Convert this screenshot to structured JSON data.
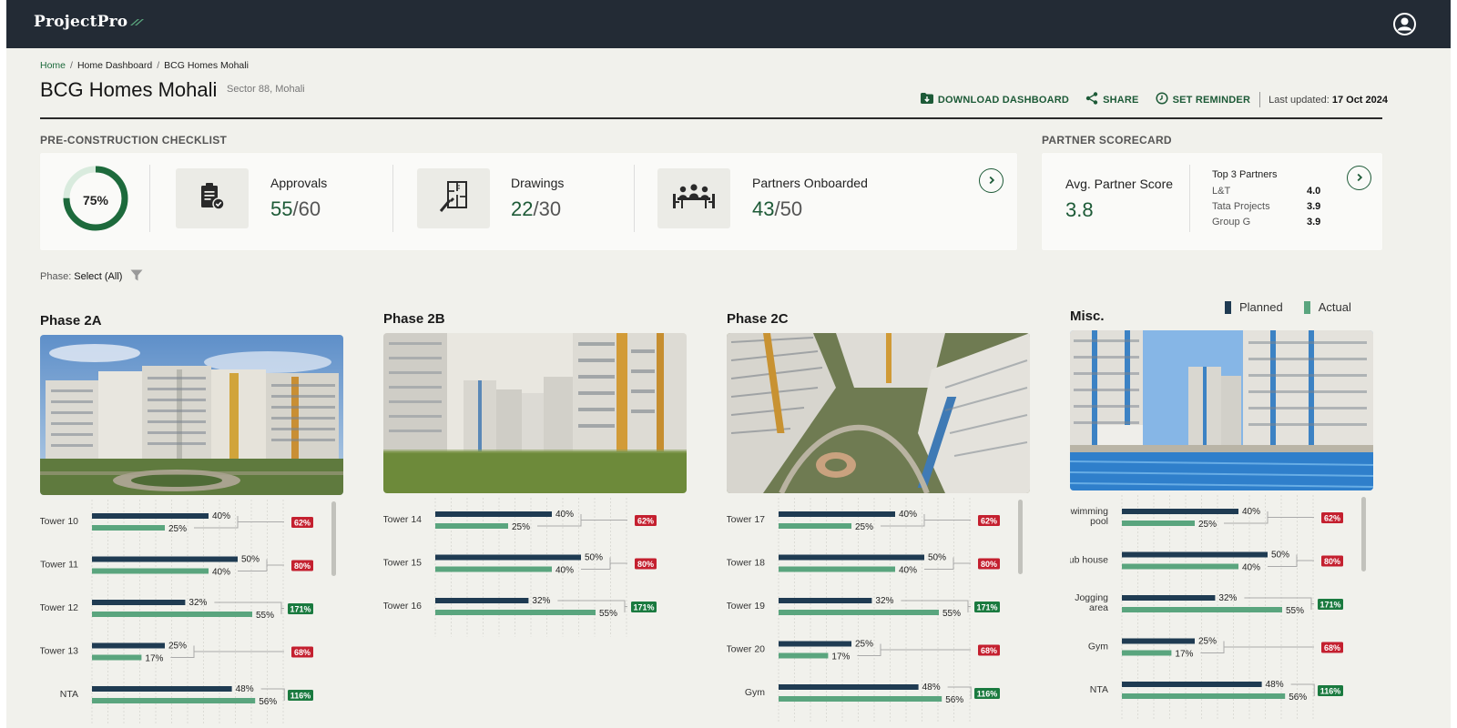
{
  "app": {
    "brand": "ProjectPro"
  },
  "breadcrumb": {
    "home": "Home",
    "sep1": "/",
    "dashboard": "Home Dashboard",
    "sep2": "/",
    "current": "BCG Homes Mohali"
  },
  "page": {
    "title": "BCG Homes Mohali",
    "subtitle": "Sector 88, Mohali"
  },
  "actions": {
    "download": "DOWNLOAD DASHBOARD",
    "share": "SHARE",
    "reminder": "SET REMINDER",
    "last_updated_label": "Last updated:",
    "last_updated_value": "17 Oct 2024"
  },
  "checklist": {
    "label": "PRE-CONSTRUCTION CHECKLIST",
    "progress_label": "75%",
    "progress_fraction": 0.75,
    "kpis": [
      {
        "title": "Approvals",
        "done": "55",
        "total": "/60",
        "icon": "clipboard-check-icon"
      },
      {
        "title": "Drawings",
        "done": "22",
        "total": "/30",
        "icon": "blueprint-icon"
      },
      {
        "title": "Partners Onboarded",
        "done": "43",
        "total": "/50",
        "icon": "meeting-icon"
      }
    ]
  },
  "scorecard": {
    "label": "PARTNER SCORECARD",
    "avg_title": "Avg. Partner Score",
    "avg_value": "3.8",
    "top_title": "Top 3 Partners",
    "partners": [
      {
        "name": "L&T",
        "score": "4.0"
      },
      {
        "name": "Tata Projects",
        "score": "3.9"
      },
      {
        "name": "Group G",
        "score": "3.9"
      }
    ]
  },
  "filter": {
    "label": "Phase:",
    "value": "Select (All)"
  },
  "legend": {
    "planned": "Planned",
    "actual": "Actual"
  },
  "colors": {
    "planned": "#1f3b52",
    "actual": "#5aa57e",
    "over": "#1a7a3f",
    "under": "#c4202f",
    "accent": "#1d5a37"
  },
  "phases": [
    {
      "title": "Phase 2A",
      "image": "buildings-garden",
      "rows": [
        {
          "label": [
            "Tower 10"
          ],
          "planned": 40,
          "actual": 25,
          "ratio": "62%",
          "status": "under"
        },
        {
          "label": [
            "Tower 11"
          ],
          "planned": 50,
          "actual": 40,
          "ratio": "80%",
          "status": "under"
        },
        {
          "label": [
            "Tower 12"
          ],
          "planned": 32,
          "actual": 55,
          "ratio": "171%",
          "status": "over"
        },
        {
          "label": [
            "Tower 13"
          ],
          "planned": 25,
          "actual": 17,
          "ratio": "68%",
          "status": "under"
        },
        {
          "label": [
            "NTA"
          ],
          "planned": 48,
          "actual": 56,
          "ratio": "116%",
          "status": "over"
        }
      ]
    },
    {
      "title": "Phase 2B",
      "image": "buildings-lawn",
      "rows": [
        {
          "label": [
            "Tower 14"
          ],
          "planned": 40,
          "actual": 25,
          "ratio": "62%",
          "status": "under"
        },
        {
          "label": [
            "Tower 15"
          ],
          "planned": 50,
          "actual": 40,
          "ratio": "80%",
          "status": "under"
        },
        {
          "label": [
            "Tower 16"
          ],
          "planned": 32,
          "actual": 55,
          "ratio": "171%",
          "status": "over"
        }
      ]
    },
    {
      "title": "Phase 2C",
      "image": "buildings-aerial",
      "rows": [
        {
          "label": [
            "Tower 17"
          ],
          "planned": 40,
          "actual": 25,
          "ratio": "62%",
          "status": "under"
        },
        {
          "label": [
            "Tower 18"
          ],
          "planned": 50,
          "actual": 40,
          "ratio": "80%",
          "status": "under"
        },
        {
          "label": [
            "Tower 19"
          ],
          "planned": 32,
          "actual": 55,
          "ratio": "171%",
          "status": "over"
        },
        {
          "label": [
            "Tower 20"
          ],
          "planned": 25,
          "actual": 17,
          "ratio": "68%",
          "status": "under"
        },
        {
          "label": [
            "Gym"
          ],
          "planned": 48,
          "actual": 56,
          "ratio": "116%",
          "status": "over"
        }
      ]
    },
    {
      "title": "Misc.",
      "image": "pool",
      "rows": [
        {
          "label": [
            "Swimming",
            "pool"
          ],
          "planned": 40,
          "actual": 25,
          "ratio": "62%",
          "status": "under"
        },
        {
          "label": [
            "Club house"
          ],
          "planned": 50,
          "actual": 40,
          "ratio": "80%",
          "status": "under"
        },
        {
          "label": [
            "Jogging",
            "area"
          ],
          "planned": 32,
          "actual": 55,
          "ratio": "171%",
          "status": "over"
        },
        {
          "label": [
            "Gym"
          ],
          "planned": 25,
          "actual": 17,
          "ratio": "68%",
          "status": "under"
        },
        {
          "label": [
            "NTA"
          ],
          "planned": 48,
          "actual": 56,
          "ratio": "116%",
          "status": "over"
        }
      ]
    }
  ]
}
